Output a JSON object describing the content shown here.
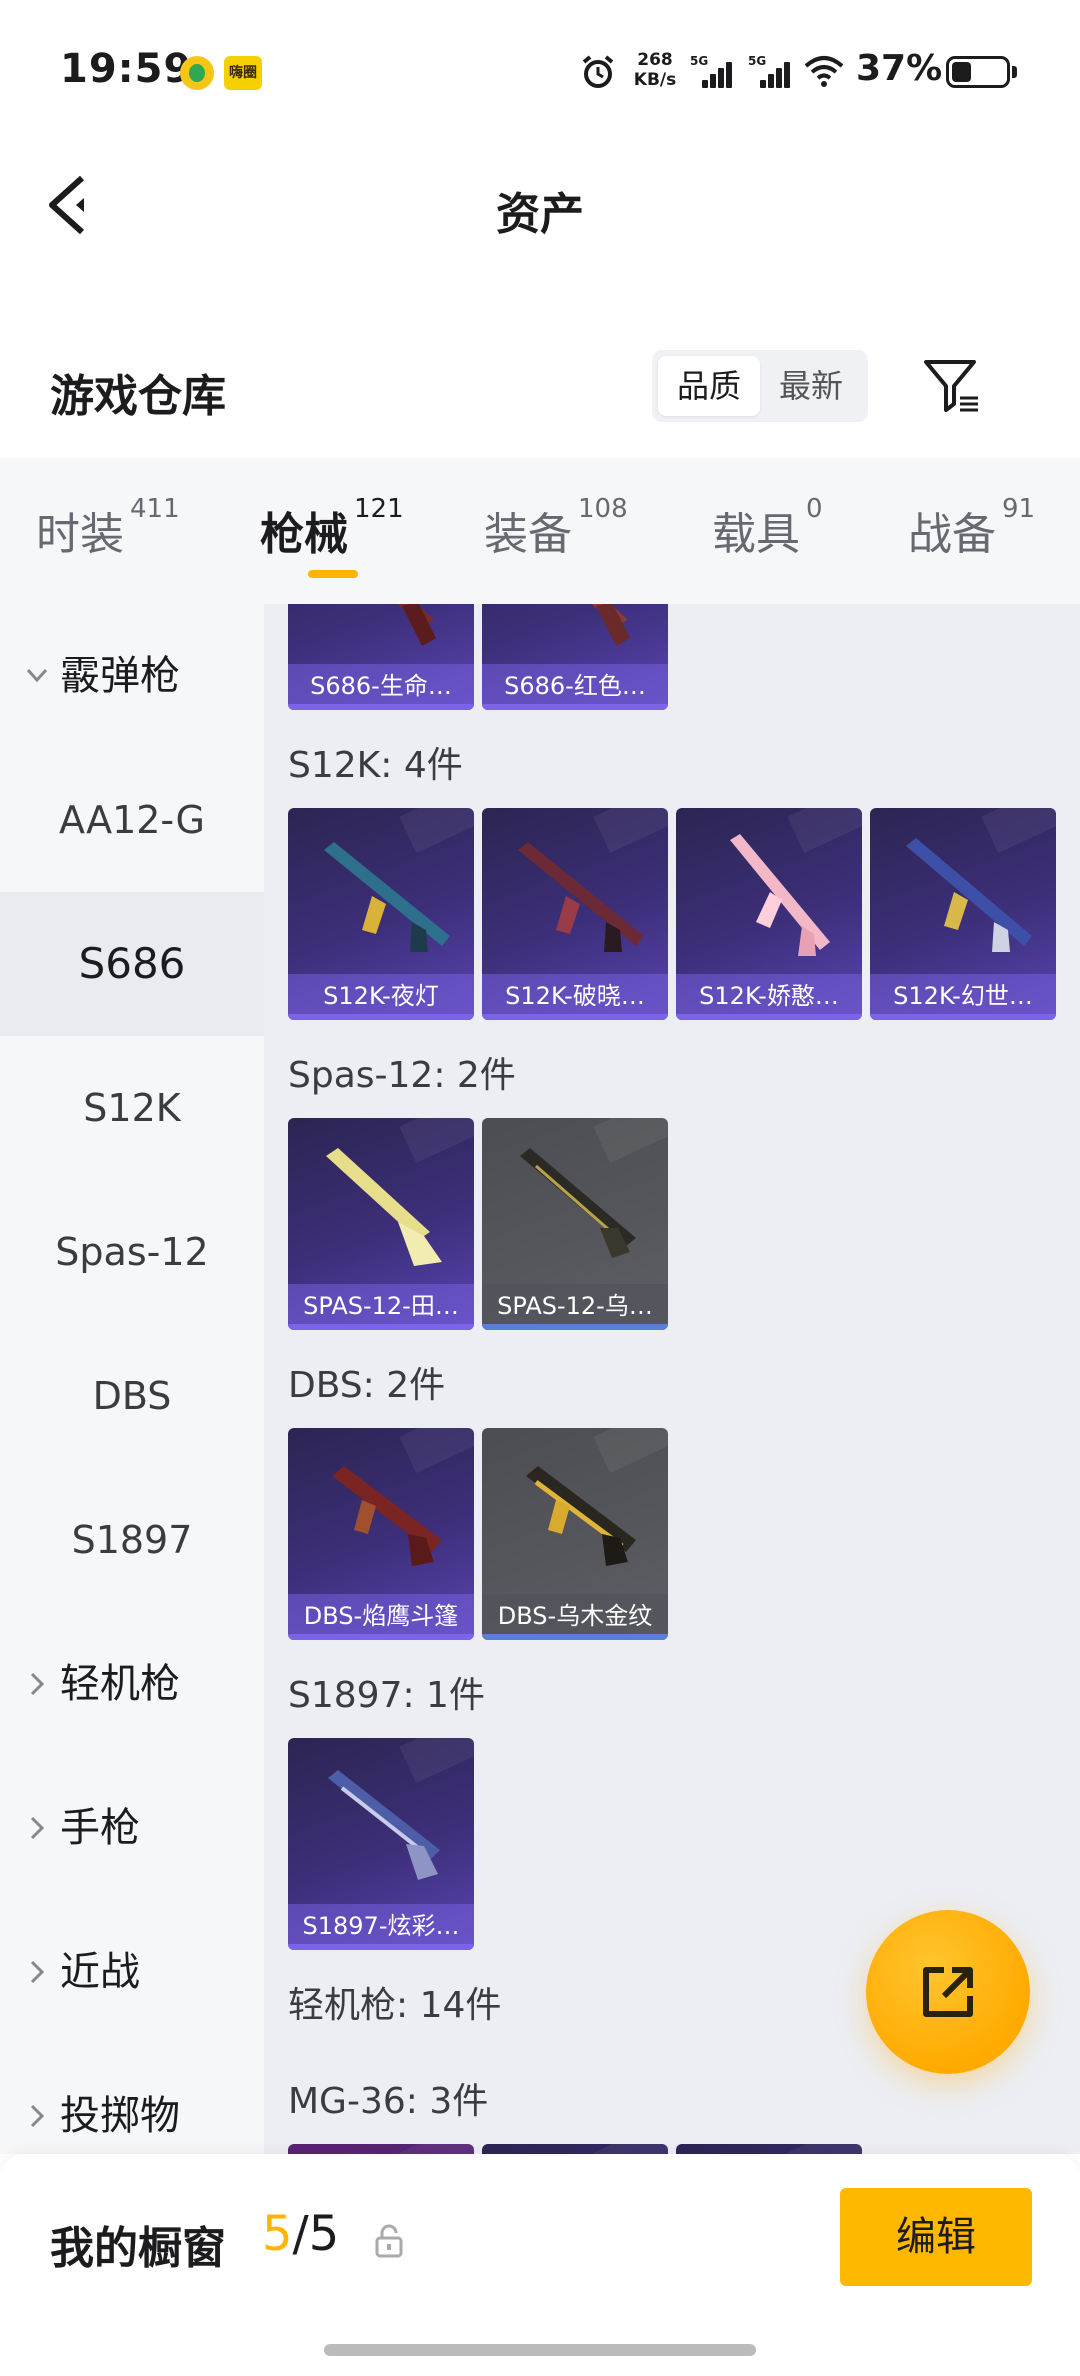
{
  "status_bar": {
    "time": "19:59",
    "app_icon_2_text": "嗨圈",
    "speed_value": "268",
    "speed_unit": "KB/s",
    "signal_1_label": "5G",
    "signal_2_label": "5G",
    "battery_text": "37%",
    "battery_level": 0.37
  },
  "header": {
    "title": "资产"
  },
  "section": {
    "title": "游戏仓库",
    "sort_quality": "品质",
    "sort_newest": "最新"
  },
  "tabs": [
    {
      "label": "时装",
      "count": "411"
    },
    {
      "label": "枪械",
      "count": "121"
    },
    {
      "label": "装备",
      "count": "108"
    },
    {
      "label": "载具",
      "count": "0"
    },
    {
      "label": "战备",
      "count": "91"
    }
  ],
  "sidebar": {
    "group_shotgun": "霰弹枪",
    "items": [
      "AA12-G",
      "S686",
      "S12K",
      "Spas-12",
      "DBS",
      "S1897"
    ],
    "group_lmg": "轻机枪",
    "group_pistol": "手枪",
    "group_melee": "近战",
    "group_throwable": "投掷物"
  },
  "content": {
    "s686_cards": [
      "S686-生命…",
      "S686-红色…"
    ],
    "s12k_label": "S12K: 4件",
    "s12k_cards": [
      "S12K-夜灯",
      "S12K-破晓…",
      "S12K-娇憨…",
      "S12K-幻世…"
    ],
    "spas_label": "Spas-12: 2件",
    "spas_cards": [
      "SPAS-12-田…",
      "SPAS-12-乌…"
    ],
    "dbs_label": "DBS: 2件",
    "dbs_cards": [
      "DBS-焰鹰斗篷",
      "DBS-乌木金纹"
    ],
    "s1897_label": "S1897: 1件",
    "s1897_cards": [
      "S1897-炫彩…"
    ],
    "lmg_label": "轻机枪: 14件",
    "mg36_label": "MG-36: 3件"
  },
  "bottom_bar": {
    "title": "我的橱窗",
    "count_current": "5",
    "count_sep_total": "/5",
    "edit_label": "编辑"
  },
  "colors": {
    "accent": "#ffb400",
    "card_purple": "#3d2f7a",
    "card_grey": "#56575c"
  }
}
